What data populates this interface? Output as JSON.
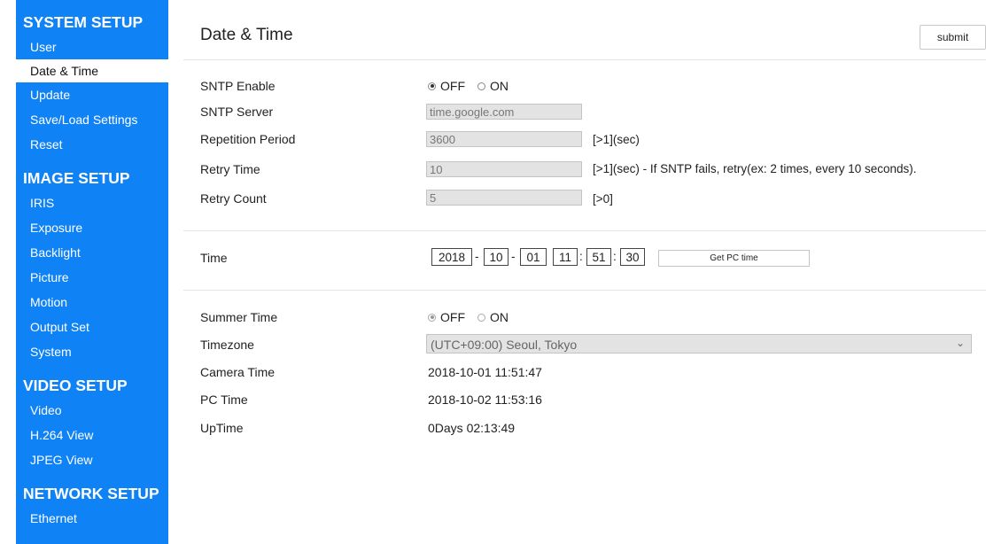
{
  "sidebar": {
    "sections": [
      {
        "title": "SYSTEM SETUP",
        "items": [
          "User",
          "Date & Time",
          "Update",
          "Save/Load Settings",
          "Reset"
        ]
      },
      {
        "title": "IMAGE SETUP",
        "items": [
          "IRIS",
          "Exposure",
          "Backlight",
          "Picture",
          "Motion",
          "Output Set",
          "System"
        ]
      },
      {
        "title": "VIDEO SETUP",
        "items": [
          "Video",
          "H.264 View",
          "JPEG View"
        ]
      },
      {
        "title": "NETWORK SETUP",
        "items": [
          "Ethernet"
        ]
      }
    ],
    "active_item": "Date & Time"
  },
  "page": {
    "title": "Date & Time",
    "submit_label": "submit"
  },
  "sntp": {
    "enable_label": "SNTP Enable",
    "enable_options": [
      "OFF",
      "ON"
    ],
    "enable_selected": "OFF",
    "server_label": "SNTP Server",
    "server_value": "time.google.com",
    "period_label": "Repetition Period",
    "period_value": "3600",
    "period_hint": "[>1](sec)",
    "retry_time_label": "Retry Time",
    "retry_time_value": "10",
    "retry_time_hint": "[>1](sec) - If SNTP fails, retry(ex: 2 times, every 10 seconds).",
    "retry_count_label": "Retry Count",
    "retry_count_value": "5",
    "retry_count_hint": "[>0]"
  },
  "time": {
    "label": "Time",
    "year": "2018",
    "month": "10",
    "day": "01",
    "hour": "11",
    "minute": "51",
    "second": "30",
    "date_sep": "-",
    "time_sep": ":",
    "get_pc_time_label": "Get PC time"
  },
  "status": {
    "summer_label": "Summer Time",
    "summer_options": [
      "OFF",
      "ON"
    ],
    "summer_selected": "OFF",
    "timezone_label": "Timezone",
    "timezone_value": "(UTC+09:00) Seoul, Tokyo",
    "camera_time_label": "Camera Time",
    "camera_time_value": "2018-10-01 11:51:47",
    "pc_time_label": "PC Time",
    "pc_time_value": "2018-10-02 11:53:16",
    "uptime_label": "UpTime",
    "uptime_value": "0Days 02:13:49"
  },
  "colors": {
    "sidebar_bg": "#0f82f5",
    "field_bg": "#e3e3e3"
  }
}
